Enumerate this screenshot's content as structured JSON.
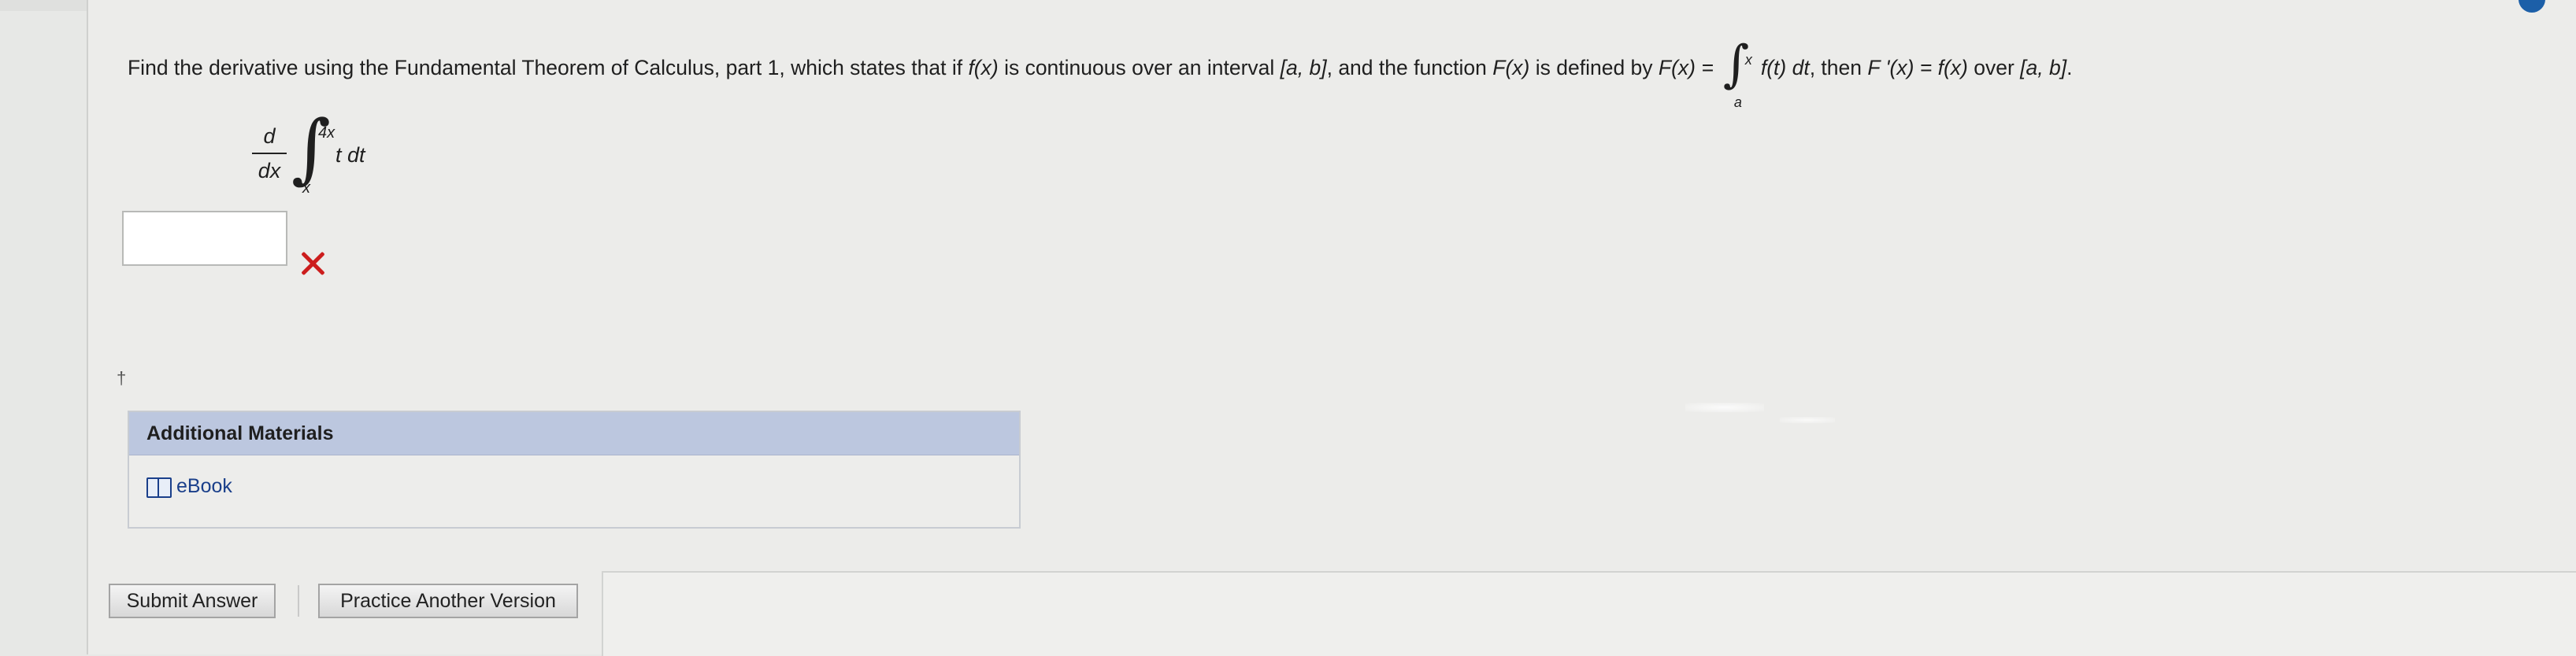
{
  "question": {
    "intro": "Find the derivative using the Fundamental Theorem of Calculus, part 1, which states that if ",
    "fx": "f(x)",
    "part2": " is continuous over an interval ",
    "interval": "[a, b]",
    "part3": ", and the function ",
    "Fx": "F(x)",
    "part4": " is defined by ",
    "Fx_eq": "F(x) =",
    "int_upper": "x",
    "int_lower": "a",
    "integrand": "f(t) dt",
    "part5": ", then ",
    "Fprime": "F '(x) = f(x)",
    "part6": " over ",
    "interval2": "[a, b]",
    "end": "."
  },
  "problem": {
    "d_num": "d",
    "d_den": "dx",
    "upper": "4x",
    "lower": "x",
    "integrand": "t dt"
  },
  "answer": {
    "value": "",
    "status": "incorrect"
  },
  "marker": "†",
  "additional_materials": {
    "title": "Additional Materials",
    "ebook_label": "eBook"
  },
  "buttons": {
    "submit": "Submit Answer",
    "practice": "Practice Another Version"
  },
  "colors": {
    "header_bar": "#bcc7df",
    "error": "#cc1d1d",
    "link": "#1a3f8a"
  }
}
